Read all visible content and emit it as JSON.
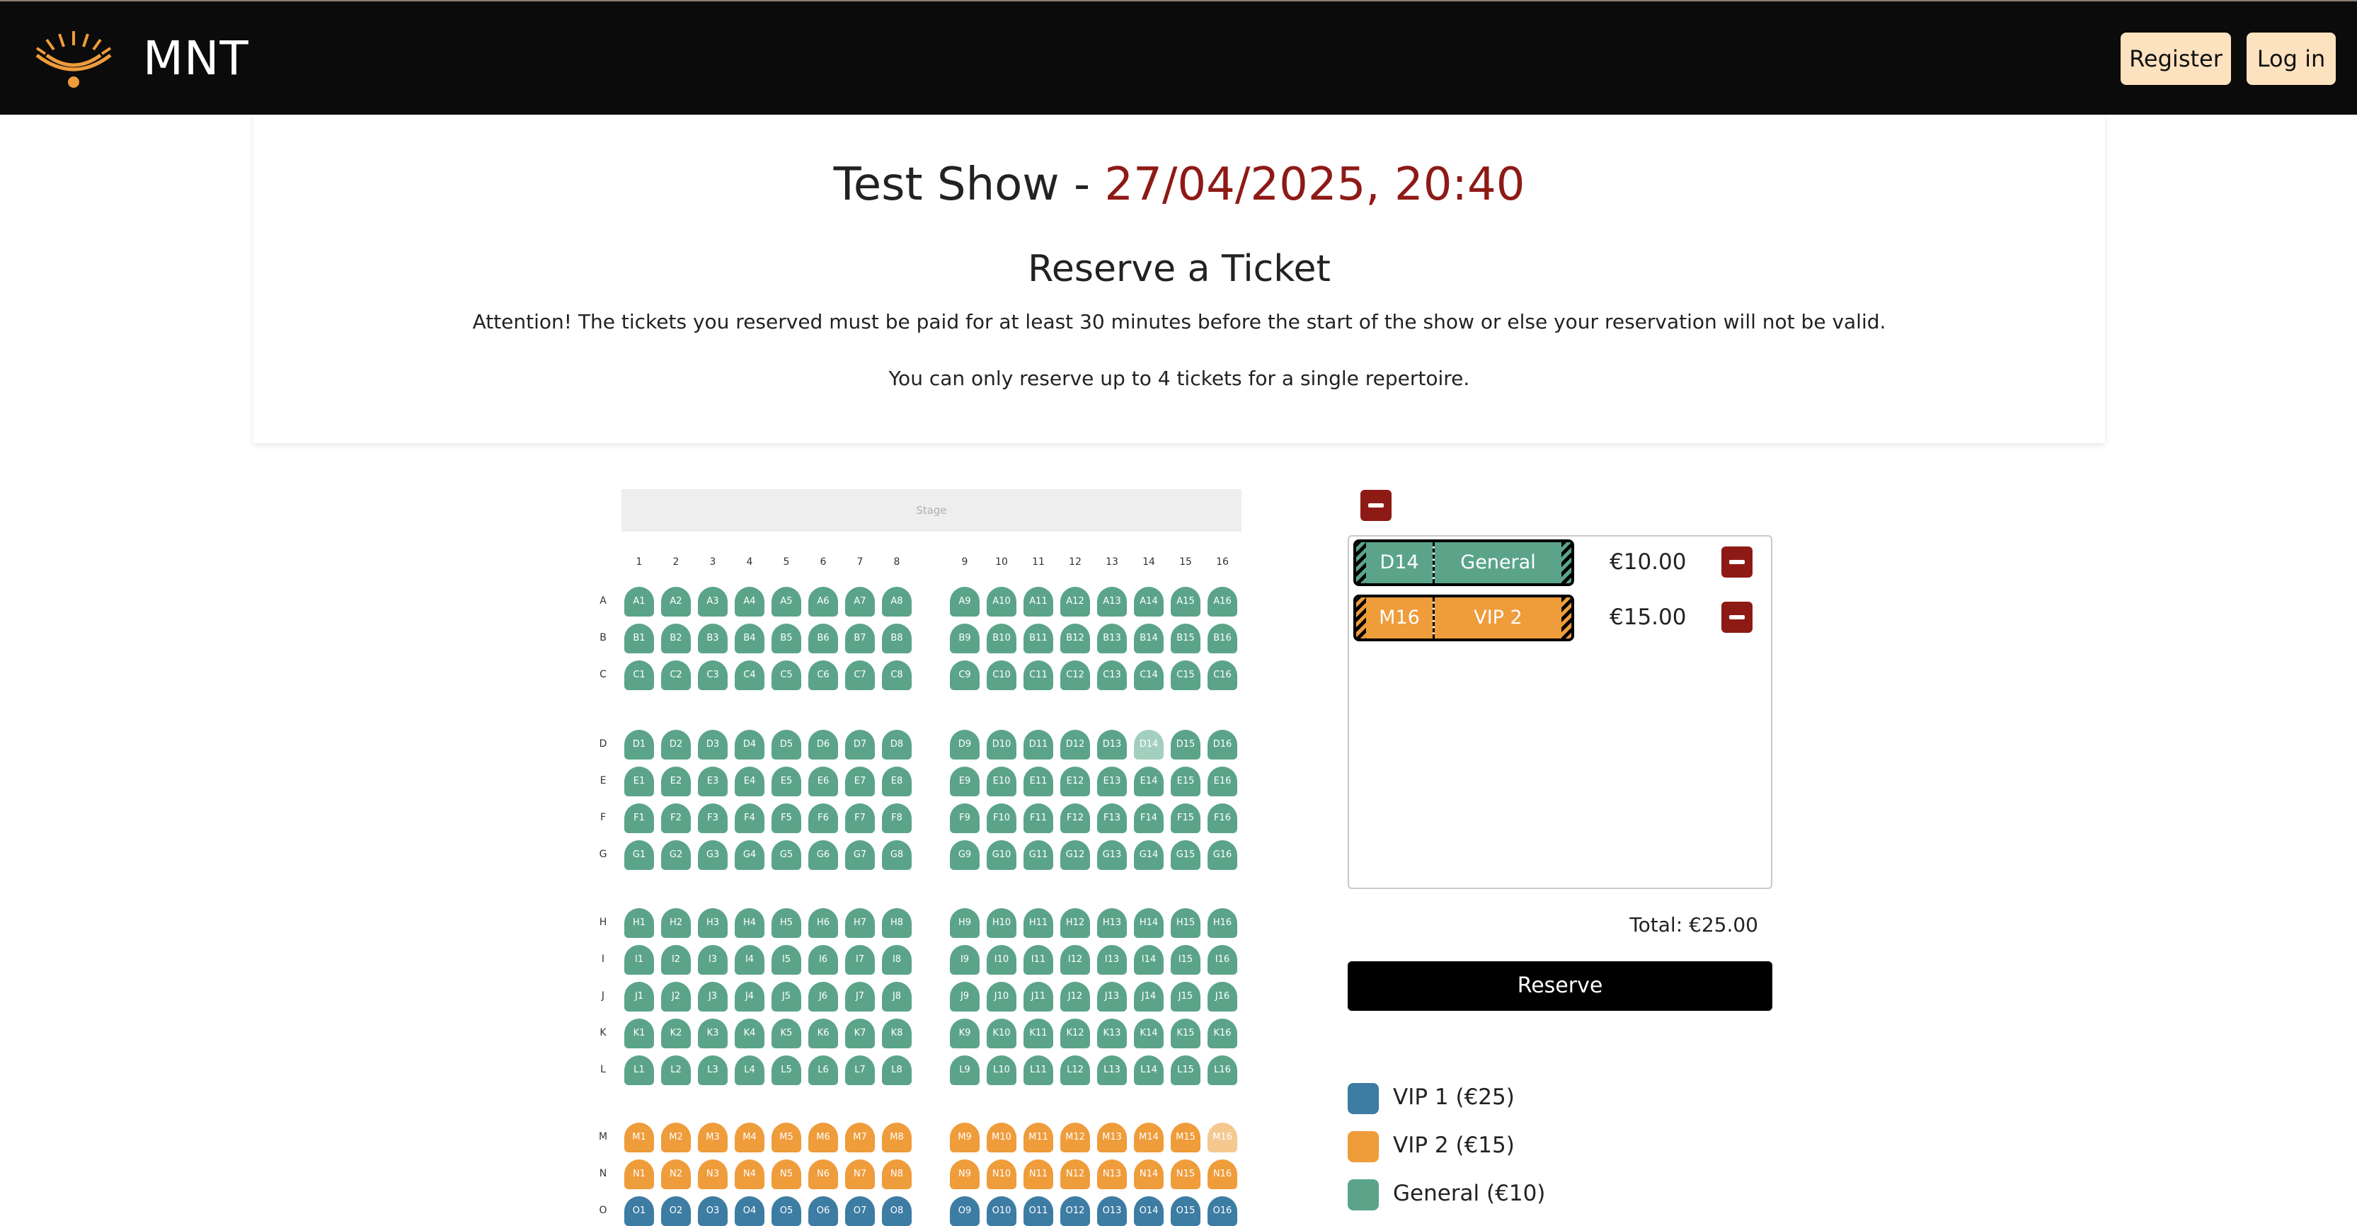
{
  "navbar": {
    "brand": "MNT",
    "register_label": "Register",
    "login_label": "Log in"
  },
  "show": {
    "name": "Test Show - ",
    "datetime": "27/04/2025, 20:40",
    "reserve_heading": "Reserve a Ticket",
    "attention_note": "Attention! The tickets you reserved must be paid for at least 30 minutes before the start of the show or else your reservation will not be valid.",
    "limit_note": "You can only reserve up to 4 tickets for a single repertoire."
  },
  "seating": {
    "stage_label": "Stage",
    "columns": [
      "1",
      "2",
      "3",
      "4",
      "5",
      "6",
      "7",
      "8",
      "9",
      "10",
      "11",
      "12",
      "13",
      "14",
      "15",
      "16"
    ],
    "row_blocks": [
      [
        "A",
        "B",
        "C"
      ],
      [
        "D",
        "E",
        "F",
        "G"
      ],
      [
        "H",
        "I",
        "J",
        "K",
        "L"
      ],
      [
        "M",
        "N",
        "O"
      ]
    ],
    "row_categories": {
      "A": "General",
      "B": "General",
      "C": "General",
      "D": "General",
      "E": "General",
      "F": "General",
      "G": "General",
      "H": "General",
      "I": "General",
      "J": "General",
      "K": "General",
      "L": "General",
      "M": "VIP 2",
      "N": "VIP 2",
      "O": "VIP 1"
    },
    "selected_seats": [
      "D14",
      "M16"
    ]
  },
  "cart": {
    "items": [
      {
        "seat": "D14",
        "category": "General",
        "price": "€10.00"
      },
      {
        "seat": "M16",
        "category": "VIP 2",
        "price": "€15.00"
      }
    ],
    "total": "Total: €25.00",
    "reserve_label": "Reserve"
  },
  "legend": [
    {
      "label": "VIP 1 (€25)",
      "category": "VIP 1"
    },
    {
      "label": "VIP 2 (€15)",
      "category": "VIP 2"
    },
    {
      "label": "General (€10)",
      "category": "General"
    }
  ],
  "colors": {
    "General": "#5ba48a",
    "VIP 2": "#ef9c3b",
    "VIP 1": "#3d7ca3",
    "General_selected": "#a3cfbf",
    "VIP 2_selected": "#f5c890",
    "accent_red": "#8e1a16",
    "date_red": "#8e1a16"
  },
  "icons": {
    "logo": "sunrise-logo-icon",
    "remove": "minus-icon"
  }
}
